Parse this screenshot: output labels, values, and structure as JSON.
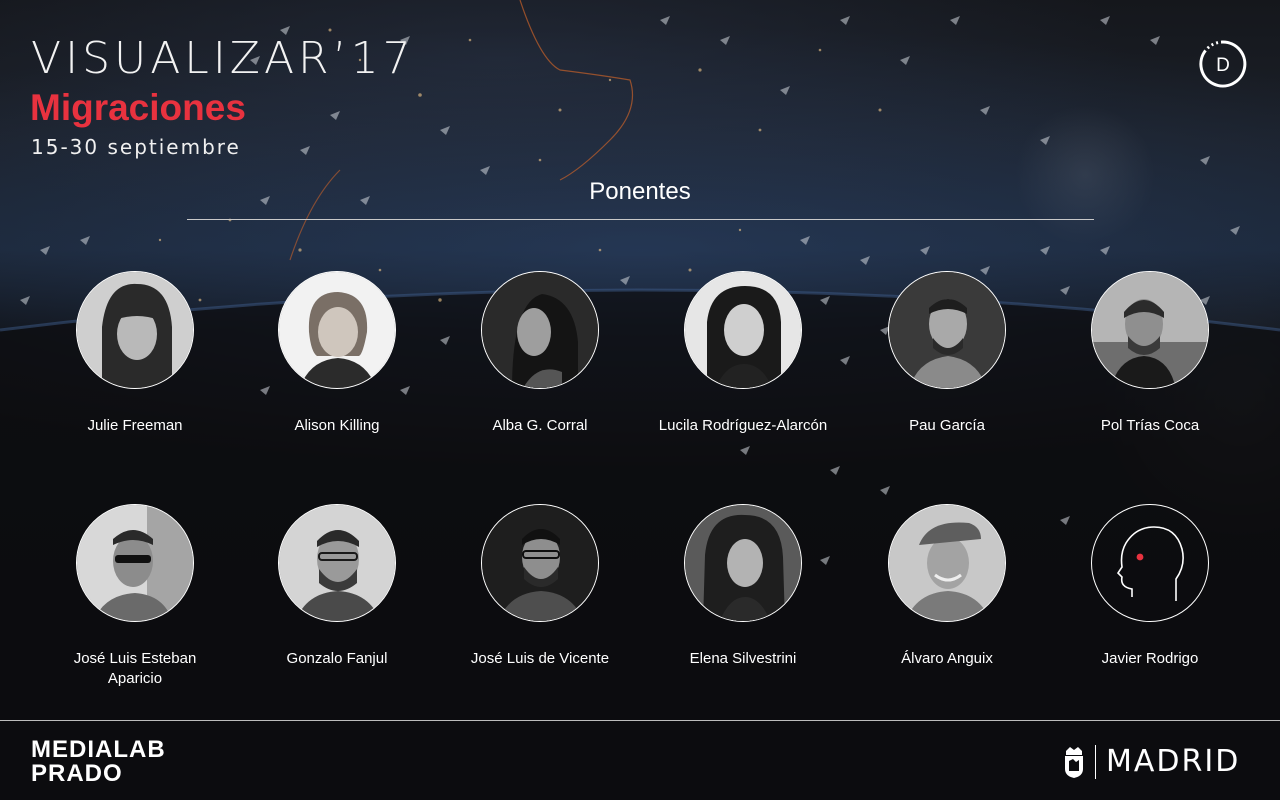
{
  "header": {
    "title": "VISUALIZAR’17",
    "subtitle": "Migraciones",
    "dates": "15-30 septiembre",
    "logo_letter": "D"
  },
  "section": {
    "title": "Ponentes"
  },
  "speakers": [
    {
      "name": "Julie Freeman",
      "photo": "portrait-photo"
    },
    {
      "name": "Alison Killing",
      "photo": "portrait-photo"
    },
    {
      "name": "Alba G. Corral",
      "photo": "portrait-photo"
    },
    {
      "name": "Lucila Rodríguez-Alarcón",
      "photo": "portrait-photo"
    },
    {
      "name": "Pau García",
      "photo": "portrait-photo"
    },
    {
      "name": "Pol Trías Coca",
      "photo": "portrait-photo"
    },
    {
      "name": "José Luis Esteban Aparicio",
      "photo": "portrait-photo"
    },
    {
      "name": "Gonzalo Fanjul",
      "photo": "portrait-photo"
    },
    {
      "name": "José Luis de Vicente",
      "photo": "portrait-photo"
    },
    {
      "name": "Elena Silvestrini",
      "photo": "portrait-photo"
    },
    {
      "name": "Álvaro Anguix",
      "photo": "portrait-photo"
    },
    {
      "name": "Javier Rodrigo",
      "photo": "head-outline-icon"
    }
  ],
  "footer": {
    "medialab_line1": "MEDIALAB",
    "medialab_line2": "PRADO",
    "madrid": "MADRID"
  },
  "colors": {
    "accent": "#e8323f",
    "text": "#ffffff",
    "background": "#0d0d0f"
  }
}
